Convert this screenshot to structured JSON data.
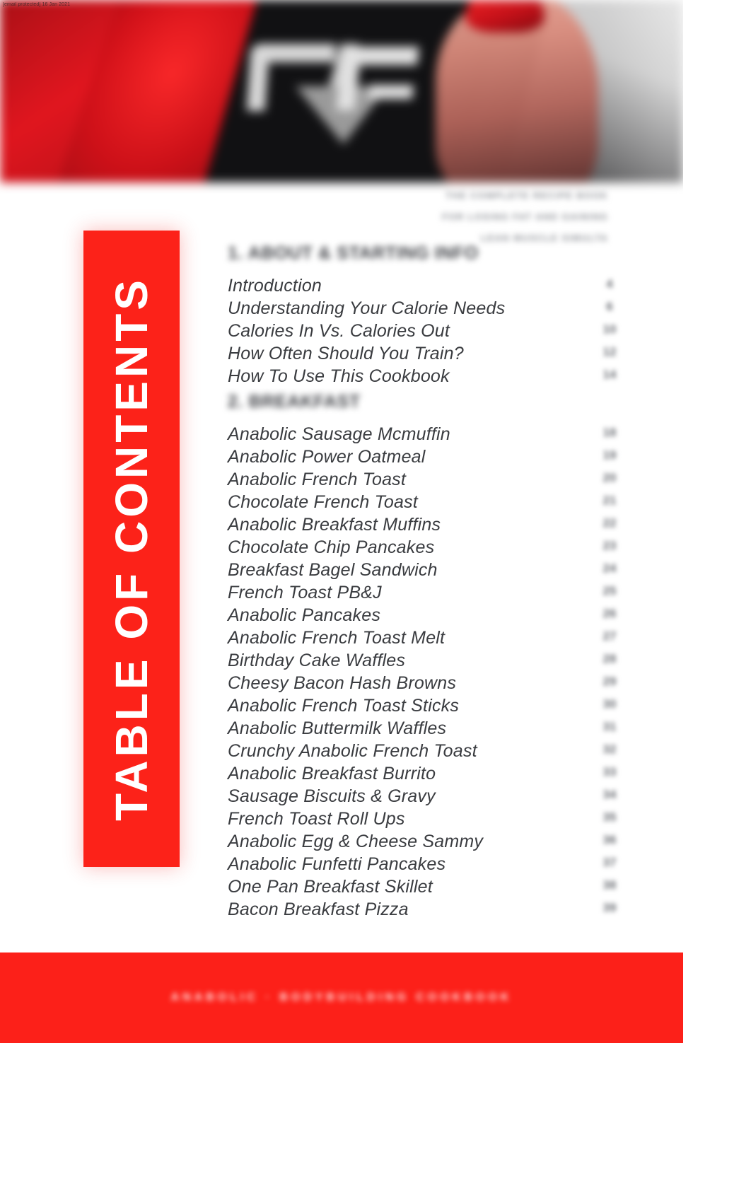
{
  "document": {
    "watermark": "[email protected] 16 Jan 2021",
    "sidebar_title": "TABLE OF CONTENTS",
    "subtitle_lines": [
      "THE COMPLETE RECIPE BOOK",
      "FOR LOSING FAT AND GAINING",
      "LEAN MUSCLE SIMULTA"
    ],
    "footer_text": "ANABOLIC · BODYBUILDING COOKBOOK"
  },
  "banner": {
    "logo_label": "rf-logo",
    "alt": "Blurred red and black fitness banner with RF logo and athlete"
  },
  "sections": [
    {
      "number": "1.",
      "heading": "1. ABOUT & STARTING INFO",
      "entries": [
        {
          "title": "Introduction",
          "page": "4"
        },
        {
          "title": "Understanding Your Calorie Needs",
          "page": "6"
        },
        {
          "title": "Calories In Vs. Calories Out",
          "page": "10"
        },
        {
          "title": "How Often Should You Train?",
          "page": "12"
        },
        {
          "title": "How To Use This Cookbook",
          "page": "14"
        }
      ]
    },
    {
      "number": "2.",
      "heading": "2. BREAKFAST",
      "entries": [
        {
          "title": "Anabolic Sausage Mcmuffin",
          "page": "18"
        },
        {
          "title": "Anabolic Power Oatmeal",
          "page": "19"
        },
        {
          "title": "Anabolic French Toast",
          "page": "20"
        },
        {
          "title": "Chocolate French Toast",
          "page": "21"
        },
        {
          "title": "Anabolic Breakfast Muffins",
          "page": "22"
        },
        {
          "title": "Chocolate Chip Pancakes",
          "page": "23"
        },
        {
          "title": "Breakfast Bagel Sandwich",
          "page": "24"
        },
        {
          "title": "French Toast PB&J",
          "page": "25"
        },
        {
          "title": "Anabolic Pancakes",
          "page": "26"
        },
        {
          "title": "Anabolic French Toast Melt",
          "page": "27"
        },
        {
          "title": "Birthday Cake Waffles",
          "page": "28"
        },
        {
          "title": "Cheesy Bacon Hash Browns",
          "page": "29"
        },
        {
          "title": "Anabolic French Toast Sticks",
          "page": "30"
        },
        {
          "title": "Anabolic Buttermilk Waffles",
          "page": "31"
        },
        {
          "title": "Crunchy Anabolic French Toast",
          "page": "32"
        },
        {
          "title": "Anabolic Breakfast Burrito",
          "page": "33"
        },
        {
          "title": "Sausage Biscuits & Gravy",
          "page": "34"
        },
        {
          "title": "French Toast Roll Ups",
          "page": "35"
        },
        {
          "title": "Anabolic Egg & Cheese Sammy",
          "page": "36"
        },
        {
          "title": "Anabolic Funfetti Pancakes",
          "page": "37"
        },
        {
          "title": "One Pan Breakfast Skillet",
          "page": "38"
        },
        {
          "title": "Bacon Breakfast Pizza",
          "page": "39"
        }
      ]
    }
  ],
  "colors": {
    "accent_red": "#fc2219",
    "text_gray": "#3a3c40",
    "page_number_gray": "#6c6f75"
  }
}
